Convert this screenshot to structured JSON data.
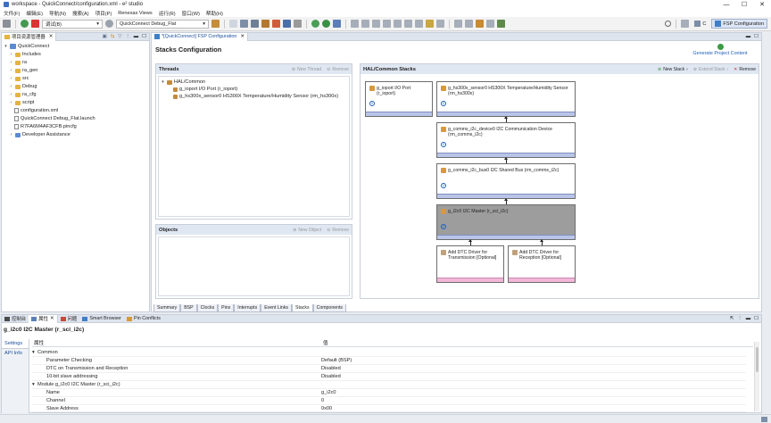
{
  "window": {
    "title": "workspace - QuickConnect/configuration.xml - e² studio",
    "minimize": "—",
    "maximize": "☐",
    "close": "✕"
  },
  "menu": [
    "文件(F)",
    "编辑(E)",
    "导航(N)",
    "搜索(A)",
    "项目(P)",
    "Renesas Views",
    "运行(R)",
    "窗口(W)",
    "帮助(H)"
  ],
  "toolbar": {
    "debug_mode": "调试(B)",
    "launch_config": "QuickConnect Debug_Flat",
    "perspective_c": "C",
    "perspective_fsp": "FSP Configuration"
  },
  "explorer": {
    "tab_label": "项目资源管理器",
    "items": [
      {
        "label": "QuickConnect",
        "icon": "project-icon",
        "expanded": true
      },
      {
        "label": "Includes",
        "icon": "folder-icon"
      },
      {
        "label": "ra",
        "icon": "folder-icon"
      },
      {
        "label": "ra_gen",
        "icon": "folder-icon"
      },
      {
        "label": "src",
        "icon": "folder-icon"
      },
      {
        "label": "Debug",
        "icon": "folder-icon"
      },
      {
        "label": "ra_cfg",
        "icon": "folder-icon"
      },
      {
        "label": "script",
        "icon": "folder-icon"
      },
      {
        "label": "configuration.xml",
        "icon": "file-icon"
      },
      {
        "label": "QuickConnect Debug_Flat.launch",
        "icon": "file-icon"
      },
      {
        "label": "R7FA6M4AF3CFB.pincfg",
        "icon": "file-icon"
      },
      {
        "label": "Developer Assistance",
        "icon": "assist-icon"
      }
    ]
  },
  "editor": {
    "tab_label": "*[QuickConnect] FSP Configuration",
    "heading": "Stacks Configuration",
    "generate_label": "Generate Project Content",
    "threads": {
      "title": "Threads",
      "new_thread": "New Thread",
      "remove": "Remove",
      "root": "HAL/Common",
      "children": [
        "g_ioport I/O Port (r_ioport)",
        "g_hs300x_sensor0 HS300X Temperature/Humidity Sensor (rm_hs300x)"
      ]
    },
    "objects": {
      "title": "Objects",
      "new_object": "New Object",
      "remove": "Remove"
    },
    "stacks": {
      "title": "HAL/Common Stacks",
      "new_stack": "New Stack",
      "extend_stack": "Extend Stack",
      "remove": "Remove",
      "components": [
        "g_ioport I/O Port (r_ioport)",
        "g_hs300x_sensor0 HS300X Temperature/Humidity Sensor (rm_hs300x)",
        "g_comms_i2c_device0 I2C Communication Device (rm_comms_i2c)",
        "g_comms_i2c_bus0 I2C Shared Bus (rm_comms_i2c)",
        "g_i2c0 I2C Master (r_sci_i2c)",
        "Add DTC Driver for Transmission [Optional]",
        "Add DTC Driver for Reception [Optional]"
      ]
    },
    "bottom_tabs": [
      "Summary",
      "BSP",
      "Clocks",
      "Pins",
      "Interrupts",
      "Event Links",
      "Stacks",
      "Components"
    ]
  },
  "bottom_panel": {
    "tabs": [
      "控制台",
      "属性",
      "问题",
      "Smart Browser",
      "Pin Conflicts"
    ],
    "title": "g_i2c0 I2C Master (r_sci_i2c)",
    "side_tabs": [
      "Settings",
      "API Info"
    ],
    "col_property": "属性",
    "col_value": "值",
    "rows": [
      {
        "key": "Common",
        "value": "",
        "level": 0,
        "group": true
      },
      {
        "key": "Parameter Checking",
        "value": "Default (BSP)",
        "level": 1
      },
      {
        "key": "DTC on Transmission and Reception",
        "value": "Disabled",
        "level": 1
      },
      {
        "key": "10-bit slave addressing",
        "value": "Disabled",
        "level": 1
      },
      {
        "key": "Module g_i2c0 I2C Master (r_sci_i2c)",
        "value": "",
        "level": 0,
        "group": true
      },
      {
        "key": "Name",
        "value": "g_i2c0",
        "level": 1
      },
      {
        "key": "Channel",
        "value": "0",
        "level": 1
      },
      {
        "key": "Slave Address",
        "value": "0x00",
        "level": 1
      }
    ]
  }
}
